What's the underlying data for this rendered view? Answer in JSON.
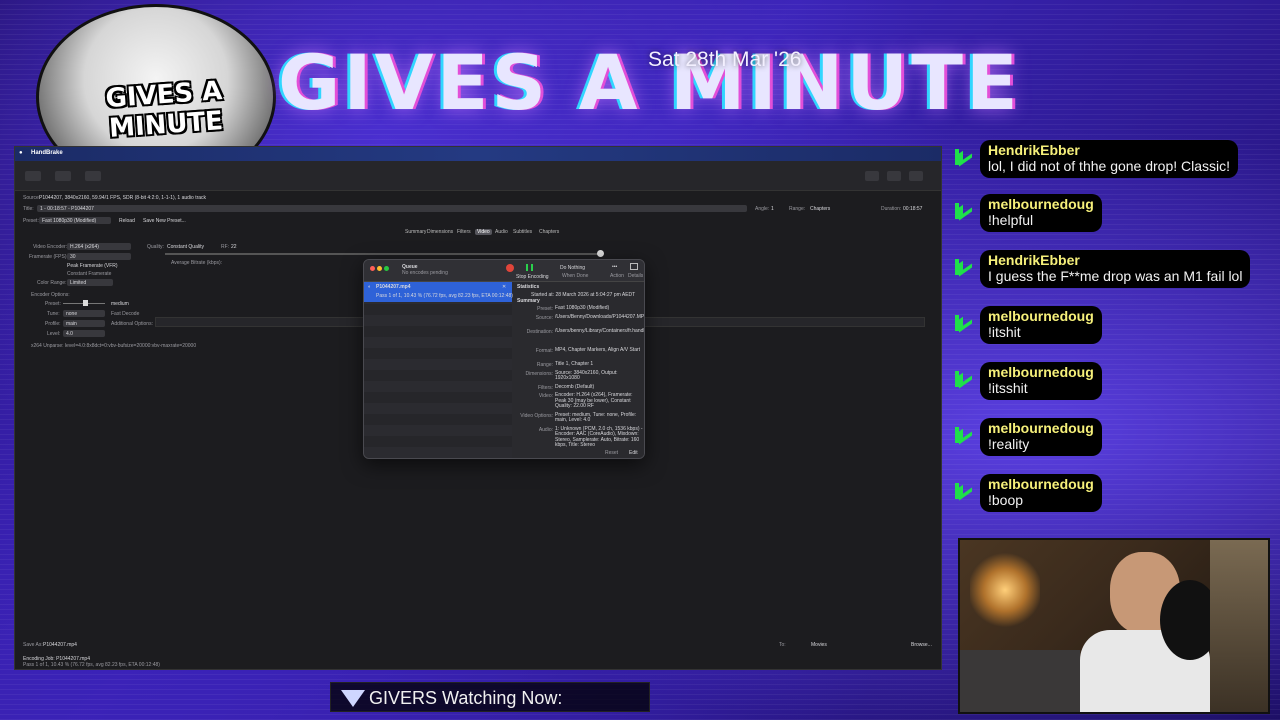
{
  "banner": {
    "title": "GIVES A MINUTE",
    "logo_text": "GIVES A MINUTE",
    "date": "Sat 28th Mar '26"
  },
  "handbrake": {
    "app_name": "HandBrake",
    "source_label": "Source:",
    "source_value": "P1044207, 3840x2160, 59.94/1 FPS, SDR (8-bit 4:2:0, 1-1-1), 1 audio track",
    "title_label": "Title:",
    "title_value": "1 - 00:18:57 - P1044207",
    "angle_label": "Angle:",
    "angle_value": "1",
    "range_label": "Range:",
    "range_value": "Chapters",
    "duration_label": "Duration:",
    "duration_value": "00:18:57",
    "preset_label": "Preset:",
    "preset_value": "Fast 1080p30 (Modified)",
    "reload_label": "Reload",
    "save_preset_label": "Save New Preset...",
    "tabs": [
      "Summary",
      "Dimensions",
      "Filters",
      "Video",
      "Audio",
      "Subtitles",
      "Chapters"
    ],
    "active_tab": "Video",
    "video_encoder_label": "Video Encoder:",
    "video_encoder_value": "H.264 (x264)",
    "framerate_label": "Framerate (FPS):",
    "framerate_value": "30",
    "peak_framerate": "Peak Framerate (VFR)",
    "constant_framerate": "Constant Framerate",
    "color_range_label": "Color Range:",
    "color_range_value": "Limited",
    "quality_label": "Quality:",
    "constant_quality": "Constant Quality",
    "rf_label": "RF:",
    "rf_value": "22",
    "average_bitrate": "Average Bitrate (kbps):",
    "encoder_options": "Encoder Options:",
    "preset_opt_label": "Preset:",
    "preset_opt_value": "medium",
    "tune_label": "Tune:",
    "tune_value": "none",
    "fast_decode": "Fast Decode",
    "profile_label": "Profile:",
    "profile_value": "main",
    "additional_options": "Additional Options:",
    "level_label": "Level:",
    "level_value": "4.0",
    "x264_unparse": "x264 Unparse: level=4.0:8x8dct=0:vbv-bufsize=20000:vbv-maxrate=20000",
    "save_as_label": "Save As:",
    "save_as_value": "P1044207.mp4",
    "to_label": "To:",
    "to_value": "Movies",
    "browse_label": "Browse...",
    "status_line1": "Encoding Job: P1044207.mp4",
    "status_line2": "Pass 1 of 1, 10.43 % (76.72 fps, avg 82.23 fps, ETA 00:12:48)"
  },
  "queue": {
    "title": "Queue",
    "subtitle": "No encodes pending",
    "stop_label": "Stop Encoding",
    "when_done_label": "Do Nothing",
    "when_done_caption": "When Done",
    "action_label": "Action",
    "details_label": "Details",
    "item_name": "P1044207.mp4",
    "item_progress": "Pass 1 of 1, 10.43 % (76.72 fps, avg 82.23 fps, ETA 00:12:48)",
    "statistics_heading": "Statistics",
    "started_at": "Started at:  28 March 2026 at 5:04:27 pm AEDT",
    "summary_heading": "Summary",
    "details": [
      {
        "k": "Preset:",
        "v": "Fast 1080p30 (Modified)"
      },
      {
        "k": "Source:",
        "v": "/Users/Benny/Downloads/P1044207.MP4"
      },
      {
        "k": "Destination:",
        "v": "/Users/benny/Library/Containers/fr.handbrake.HandBrake/Data/Movies/P1044207.mp4"
      },
      {
        "k": "Format:",
        "v": "MP4, Chapter Markers, Align A/V Start"
      },
      {
        "k": "Range:",
        "v": "Title 1, Chapter 1"
      },
      {
        "k": "Dimensions:",
        "v": "Source: 3840x2160, Output: 1920x1080"
      },
      {
        "k": "Filters:",
        "v": "Decomb (Default)"
      },
      {
        "k": "Video:",
        "v": "Encoder: H.264 (x264), Framerate: Peak 30 (may be lower), Constant Quality: 22.00 RF"
      },
      {
        "k": "Video Options:",
        "v": "Preset: medium, Tune: none, Profile: main, Level: 4.0"
      },
      {
        "k": "Audio:",
        "v": "1: Unknown (PCM, 2.0 ch, 1536 kbps) - Encoder: AAC (CoreAudio), Mixdown: Stereo, Samplerate: Auto, Bitrate: 160 kbps, Title: Stereo"
      }
    ],
    "reset_label": "Reset",
    "edit_label": "Edit"
  },
  "chat": [
    {
      "user": "HendrikEbber",
      "message": "lol, I did not of thhe gone drop! Classic!"
    },
    {
      "user": "melbournedoug",
      "message": "!helpful"
    },
    {
      "user": "HendrikEbber",
      "message": "I guess the F**me drop was an M1 fail lol"
    },
    {
      "user": "melbournedoug",
      "message": "!itshit"
    },
    {
      "user": "melbournedoug",
      "message": "!itsshit"
    },
    {
      "user": "melbournedoug",
      "message": "!reality"
    },
    {
      "user": "melbournedoug",
      "message": "!boop"
    }
  ],
  "bottom": {
    "watching_label": "GIVERS Watching Now:"
  },
  "colors": {
    "chat_username": "#f6f07a",
    "chat_icon": "#1fe04a",
    "queue_selection": "#2e62d8",
    "background": "#3a23b5"
  }
}
